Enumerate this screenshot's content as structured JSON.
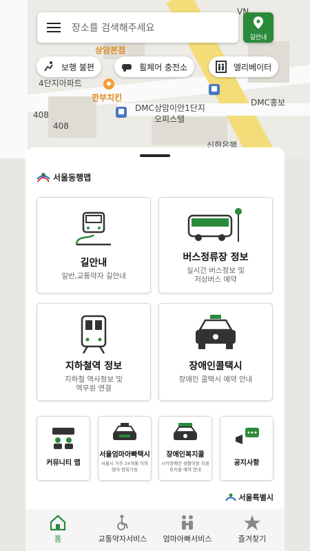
{
  "search": {
    "placeholder": "장소를 검색해주세요",
    "nav_label": "길안내"
  },
  "chips": [
    {
      "label": "보행 불편"
    },
    {
      "label": "휠체어 충전소"
    },
    {
      "label": "엘리베이터"
    }
  ],
  "map": {
    "labels": [
      "상암본점",
      "4단지아파트",
      "깐부치킨",
      "DMC상암이안1단지",
      "오피스텔",
      "DMC홍보",
      "신한은행",
      "408",
      "408",
      "VN"
    ]
  },
  "brand": "서울동행맵",
  "cards": {
    "route": {
      "title": "길안내",
      "sub": "일반,교통약자 길안내"
    },
    "bus": {
      "title": "버스정류장 정보",
      "sub1": "실시간 버스정보 및",
      "sub2": "저상버스 예약"
    },
    "subway": {
      "title": "지하철역 정보",
      "sub1": "지하철 역사정보 및",
      "sub2": "역무원 연결"
    },
    "taxi": {
      "title": "장애인콜택시",
      "sub": "장애인 콜택시 예약 안내"
    }
  },
  "small_cards": [
    {
      "title": "커뮤니티 맵",
      "sub1": "",
      "sub2": ""
    },
    {
      "title": "서울엄마아빠택시",
      "sub1": "서울시 거주 24개월 이하",
      "sub2": "영아 양육가정"
    },
    {
      "title": "장애인복지콜",
      "sub1": "시각장애인 생활이동 지원",
      "sub2": "휴지콜 예약 안내"
    },
    {
      "title": "공지사항",
      "sub1": "",
      "sub2": ""
    }
  ],
  "seoul_logo": "서울특별시",
  "tabs": [
    {
      "label": "홈"
    },
    {
      "label": "교통약자서비스"
    },
    {
      "label": "엄마아빠서비스"
    },
    {
      "label": "즐겨찾기"
    }
  ],
  "colors": {
    "accent": "#2a8a3a",
    "bus": "#4a78c2",
    "food": "#f39c32"
  }
}
